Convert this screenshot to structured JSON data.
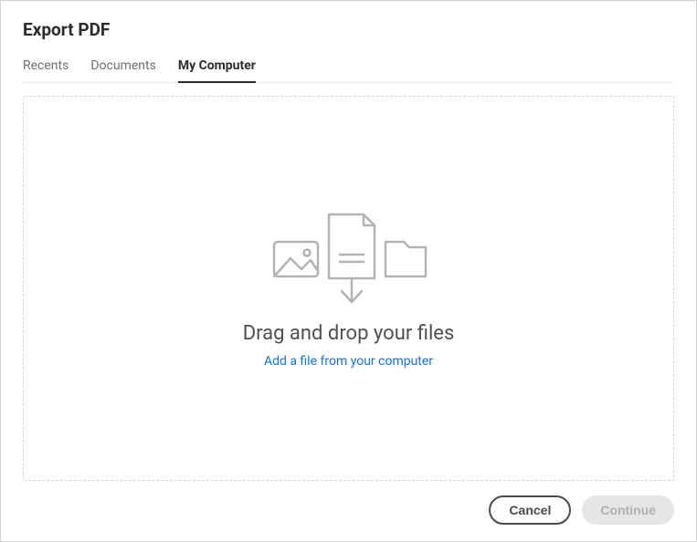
{
  "title": "Export PDF",
  "tabs": {
    "recents": "Recents",
    "documents": "Documents",
    "myComputer": "My Computer"
  },
  "dropzone": {
    "title": "Drag and drop your files",
    "link": "Add a file from your computer"
  },
  "footer": {
    "cancel": "Cancel",
    "continue": "Continue"
  }
}
